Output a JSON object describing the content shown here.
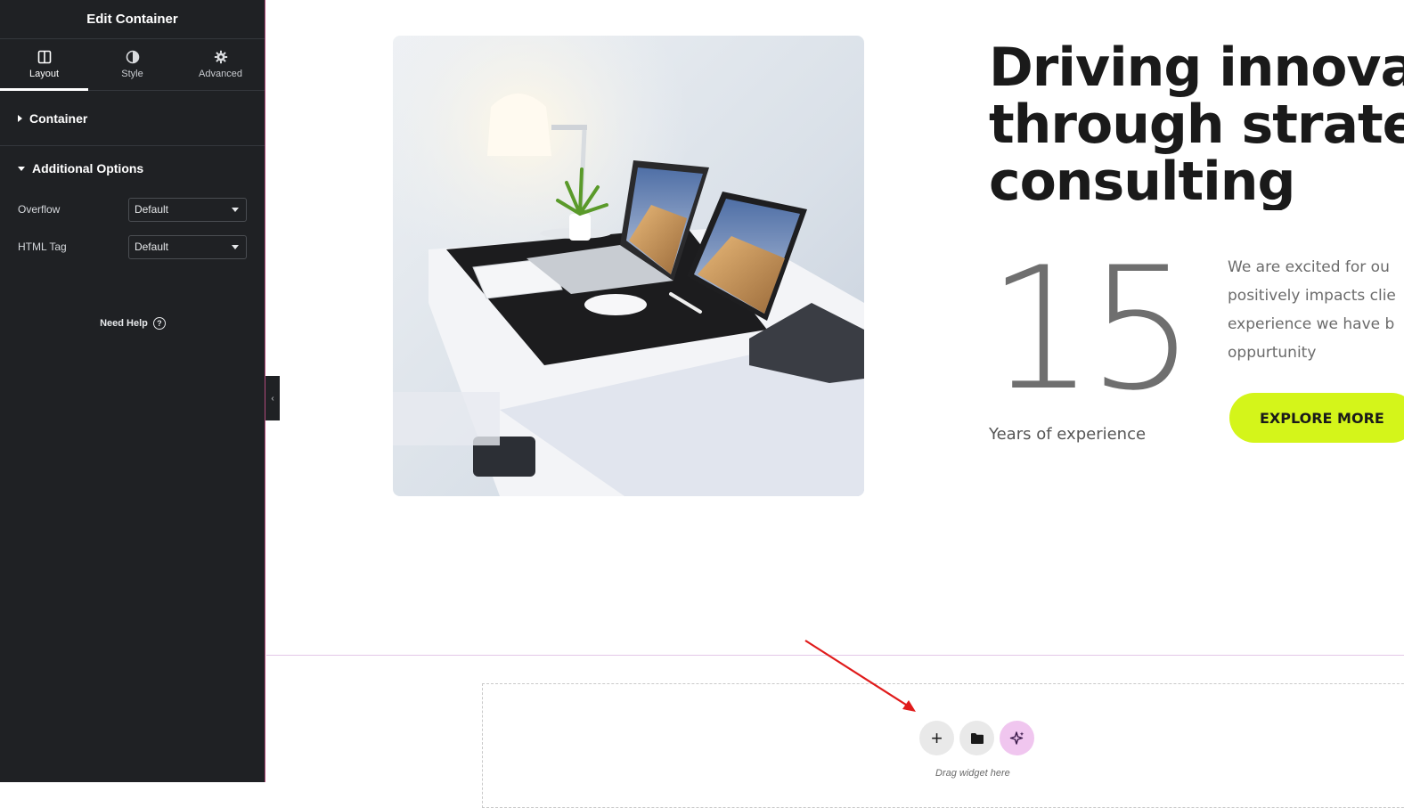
{
  "sidebar": {
    "title": "Edit Container",
    "tabs": [
      {
        "label": "Layout",
        "icon": "layout-icon",
        "active": true
      },
      {
        "label": "Style",
        "icon": "contrast-icon",
        "active": false
      },
      {
        "label": "Advanced",
        "icon": "gear-icon",
        "active": false
      }
    ],
    "sections": {
      "container": "Container",
      "additional": "Additional Options"
    },
    "controls": [
      {
        "label": "Overflow",
        "value": "Default"
      },
      {
        "label": "HTML Tag",
        "value": "Default"
      }
    ],
    "need_help": "Need Help",
    "help_icon_glyph": "?",
    "collapse_glyph": "‹"
  },
  "canvas": {
    "headline": [
      "Driving innovat",
      "through strateg",
      "consulting"
    ],
    "big_number": "15",
    "years_label": "Years of experience",
    "description": [
      "We are excited for ou",
      "positively impacts clie",
      "experience we have b",
      "oppurtunity"
    ],
    "cta_label": "EXPLORE MORE",
    "add_glyph": "+",
    "drag_hint": "Drag widget here"
  },
  "colors": {
    "sidebar_bg": "#1f2124",
    "accent_lime": "#d4f51a",
    "ai_button": "#f0c6ef",
    "annotation_arrow": "#e01b1b"
  }
}
